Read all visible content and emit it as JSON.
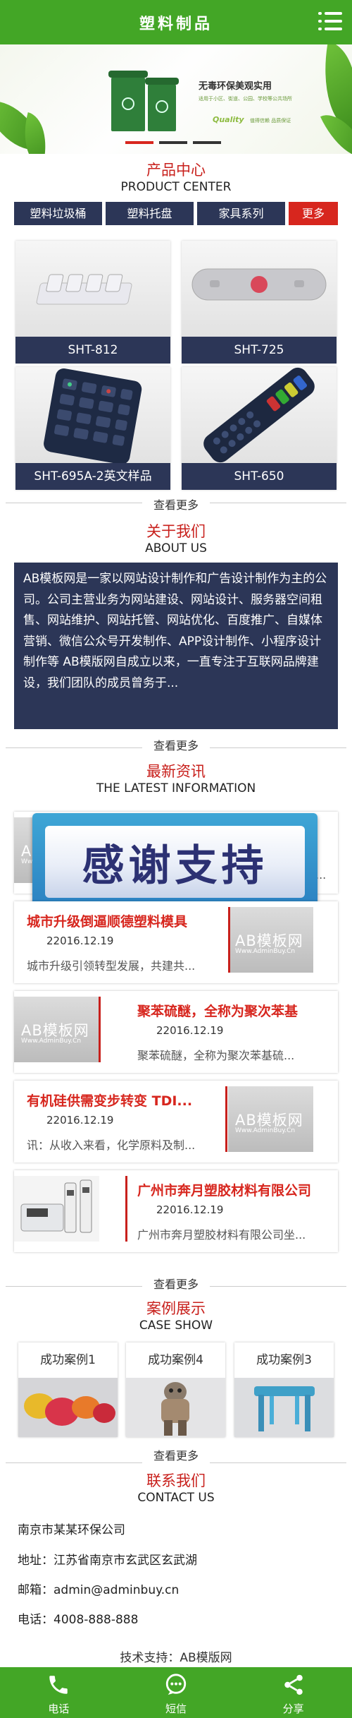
{
  "header": {
    "title": "塑料制品",
    "menu_icon": "list-menu-icon"
  },
  "banner": {
    "headline": "无毒环保美观实用",
    "sub": "适用于小区、街道、公园、学校等公共场所",
    "quality": "Quality",
    "quality_sub": "值得信赖 品质保证",
    "slides": 3,
    "active_slide": 1
  },
  "products": {
    "title_cn": "产品中心",
    "title_en": "PRODUCT CENTER",
    "categories": [
      "塑料垃圾桶",
      "塑料托盘",
      "家具系列",
      "更多"
    ],
    "items": [
      {
        "name": "SHT-812"
      },
      {
        "name": "SHT-725"
      },
      {
        "name": "SHT-695A-2英文样品"
      },
      {
        "name": "SHT-650"
      }
    ],
    "more": "查看更多"
  },
  "about": {
    "title_cn": "关于我们",
    "title_en": "ABOUT US",
    "text": "AB模板网是一家以网站设计制作和广告设计制作为主的公司。公司主营业务为网站建设、网站设计、服务器空间租售、网站维护、网站托管、网站优化、百度推广、自媒体营销、微信公众号开发制作、APP设计制作、小程序设计制作等 AB模版网自成立以来，一直专注于互联网品牌建设，我们团队的成员曾务于...",
    "more": "查看更多"
  },
  "news": {
    "title_cn": "最新资讯",
    "title_en": "THE LATEST INFORMATION",
    "overlay": "感谢支持",
    "items": [
      {
        "title": "",
        "date": "",
        "desc": "...",
        "wm1": "AB模板网",
        "wm2": "Www.AdminBuy.Cn"
      },
      {
        "title": "城市升级倒逼顺德塑料模具",
        "date": "22016.12.19",
        "desc": "城市升级引领转型发展，共建共...",
        "wm1": "AB模板网",
        "wm2": "Www.AdminBuy.Cn"
      },
      {
        "title": "聚苯硫醚，全称为聚次苯基",
        "date": "22016.12.19",
        "desc": "聚苯硫醚，全称为聚次苯基硫...",
        "wm1": "AB模板网",
        "wm2": "Www.AdminBuy.Cn"
      },
      {
        "title": "有机硅供需变步转变 TDI...",
        "date": "22016.12.19",
        "desc": "讯：从收入来看，化学原料及制...",
        "wm1": "AB模板网",
        "wm2": "Www.AdminBuy.Cn"
      },
      {
        "title": "广州市奔月塑胶材料有限公司",
        "date": "22016.12.19",
        "desc": "广州市奔月塑胶材料有限公司坐..."
      }
    ],
    "more": "查看更多"
  },
  "cases": {
    "title_cn": "案例展示",
    "title_en": "CASE SHOW",
    "items": [
      {
        "name": "成功案例1"
      },
      {
        "name": "成功案例4"
      },
      {
        "name": "成功案例3"
      }
    ],
    "more": "查看更多"
  },
  "contact": {
    "title_cn": "联系我们",
    "title_en": "CONTACT US",
    "company": "南京市某某环保公司",
    "address": "地址：江苏省南京市玄武区玄武湖",
    "email": "邮箱：admin@adminbuy.cn",
    "phone": "电话：4008-888-888"
  },
  "support": "技术支持：AB模版网",
  "footer": [
    {
      "label": "电话",
      "icon": "phone-icon"
    },
    {
      "label": "短信",
      "icon": "message-icon"
    },
    {
      "label": "分享",
      "icon": "share-icon"
    }
  ],
  "colors": {
    "green": "#43a626",
    "navy": "#2c3657",
    "red": "#d7261e"
  }
}
